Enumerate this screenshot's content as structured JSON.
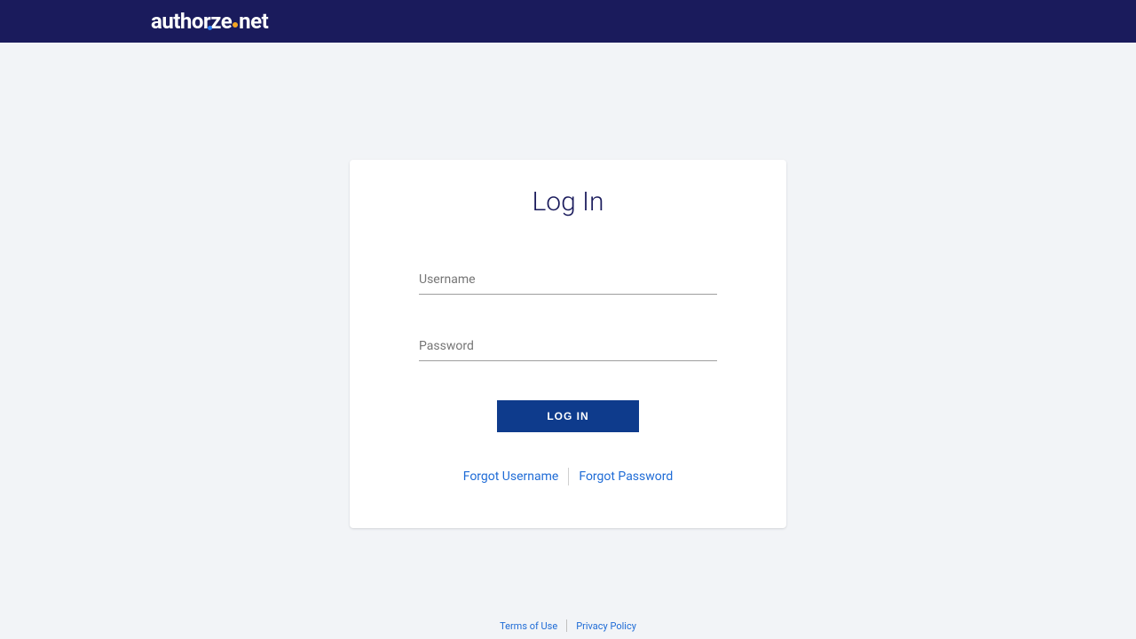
{
  "header": {
    "logo_part1": "author",
    "logo_part2": "ze",
    "logo_part3": "net"
  },
  "login": {
    "title": "Log In",
    "username_label": "Username",
    "username_value": "",
    "password_label": "Password",
    "password_value": "",
    "button_label": "LOG IN",
    "forgot_username": "Forgot Username",
    "forgot_password": "Forgot Password"
  },
  "footer": {
    "terms": "Terms of Use",
    "privacy": "Privacy Policy"
  }
}
